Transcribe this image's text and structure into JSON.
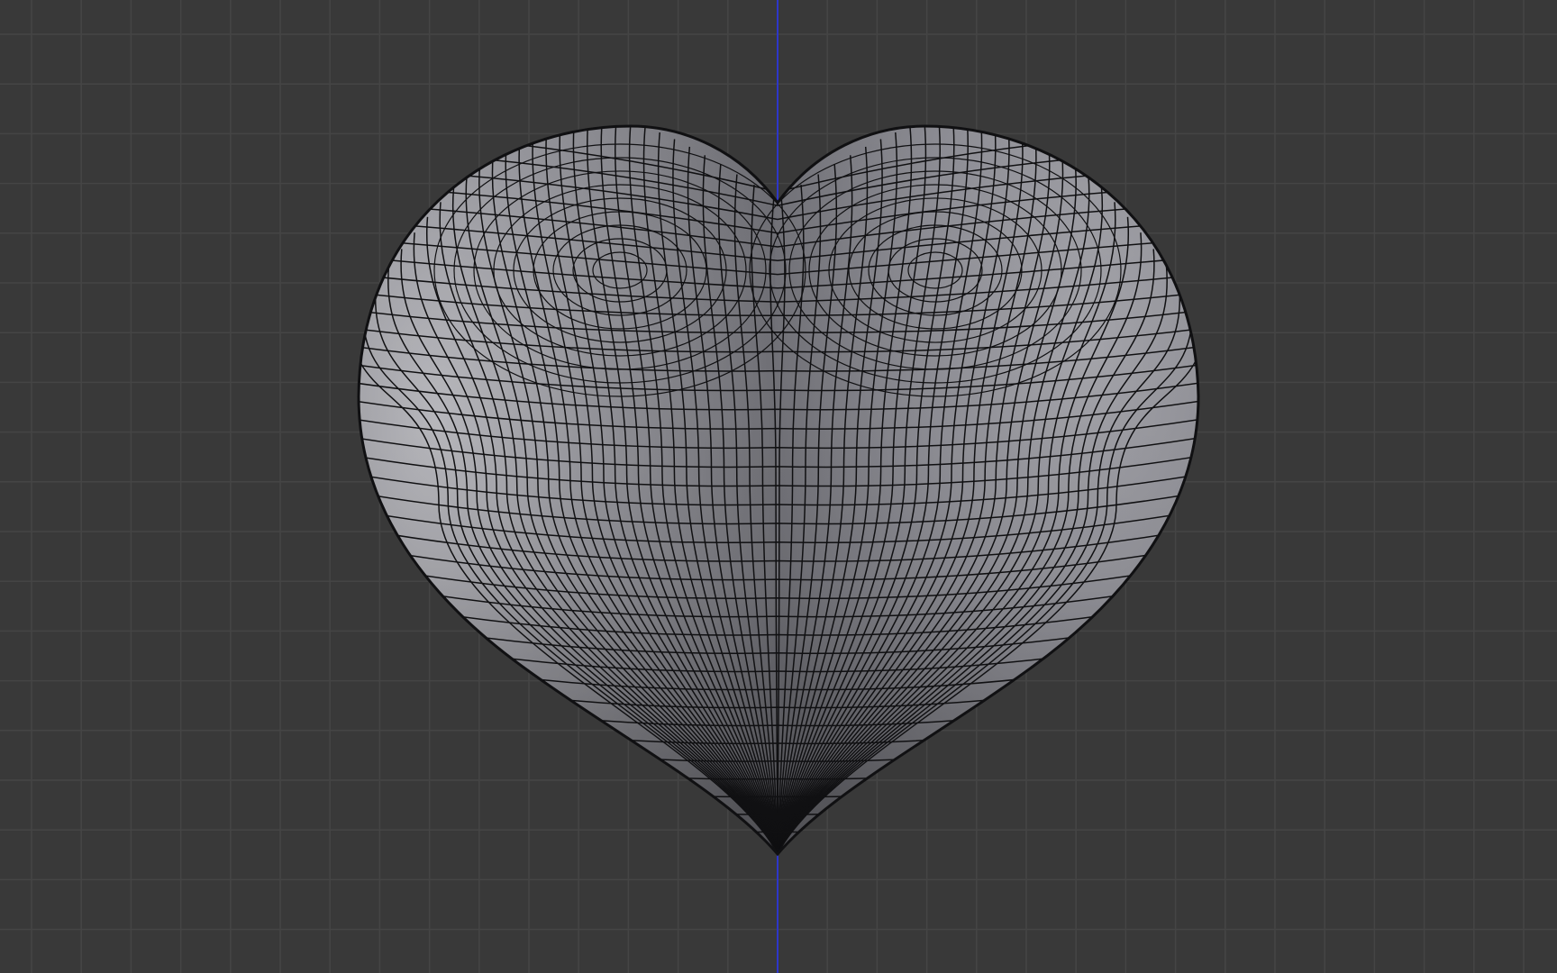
{
  "viewport": {
    "background_color": "#393939",
    "grid_color": "#454545",
    "z_axis_color": "#2d36c8",
    "view": "front-orthographic"
  },
  "mesh": {
    "object": "heart",
    "shading": "solid-with-wireframe",
    "surface_color": "#8c8c92",
    "wire_color": "#101012"
  }
}
